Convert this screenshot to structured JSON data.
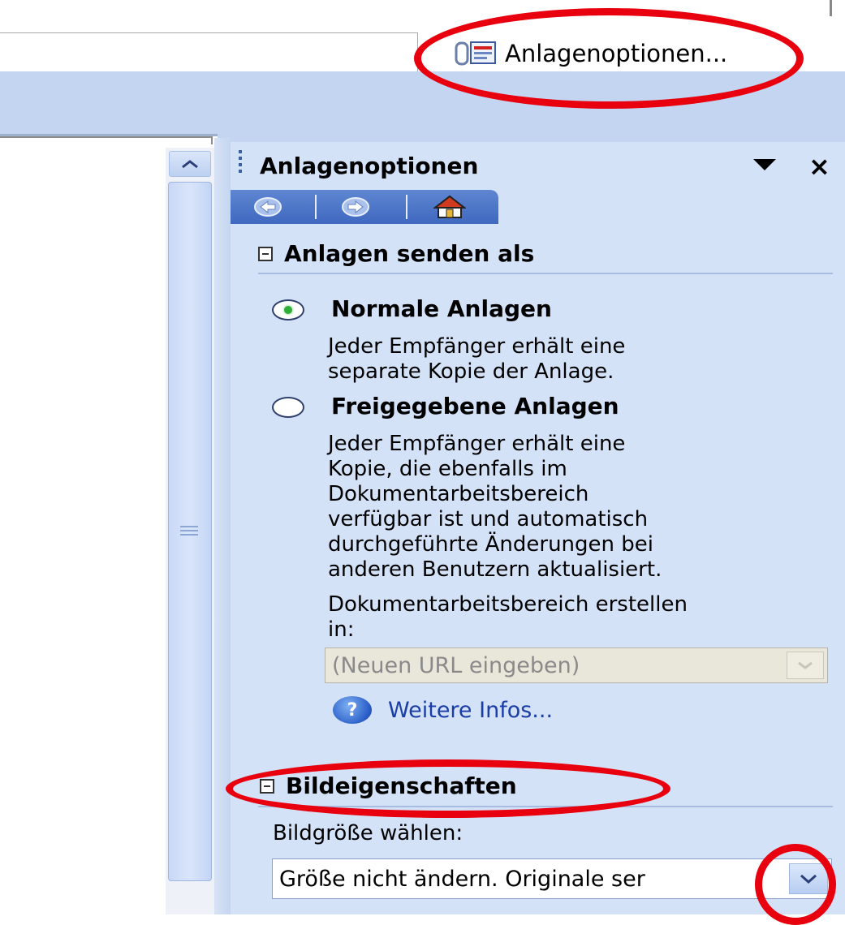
{
  "toolbar": {
    "attachment_options_label": "Anlagenoptionen..."
  },
  "pane": {
    "title": "Anlagenoptionen",
    "nav": {
      "back_icon": "back-arrow-icon",
      "forward_icon": "forward-arrow-icon",
      "home_icon": "home-icon"
    },
    "send_section": {
      "heading": "Anlagen senden als",
      "options": [
        {
          "label": "Normale Anlagen",
          "selected": true,
          "description": [
            "Jeder Empfänger erhält eine",
            "separate Kopie der Anlage."
          ]
        },
        {
          "label": "Freigegebene Anlagen",
          "selected": false,
          "description": [
            "Jeder Empfänger erhält eine",
            "Kopie, die ebenfalls im",
            "Dokumentarbeitsbereich",
            "verfügbar ist und automatisch",
            "durchgeführte Änderungen bei",
            "anderen Benutzern aktualisiert."
          ]
        }
      ],
      "workspace_label": [
        "Dokumentarbeitsbereich erstellen",
        "in:"
      ],
      "url_placeholder": "(Neuen URL eingeben)",
      "more_info": "Weitere Infos..."
    },
    "image_section": {
      "heading": "Bildeigenschaften",
      "size_label": "Bildgröße wählen:",
      "size_value": "Größe nicht ändern. Originale ser"
    }
  },
  "colors": {
    "annotation_red": "#e8000f",
    "pane_bg": "#d4e2f8",
    "nav_blue": "#3f68c0"
  }
}
